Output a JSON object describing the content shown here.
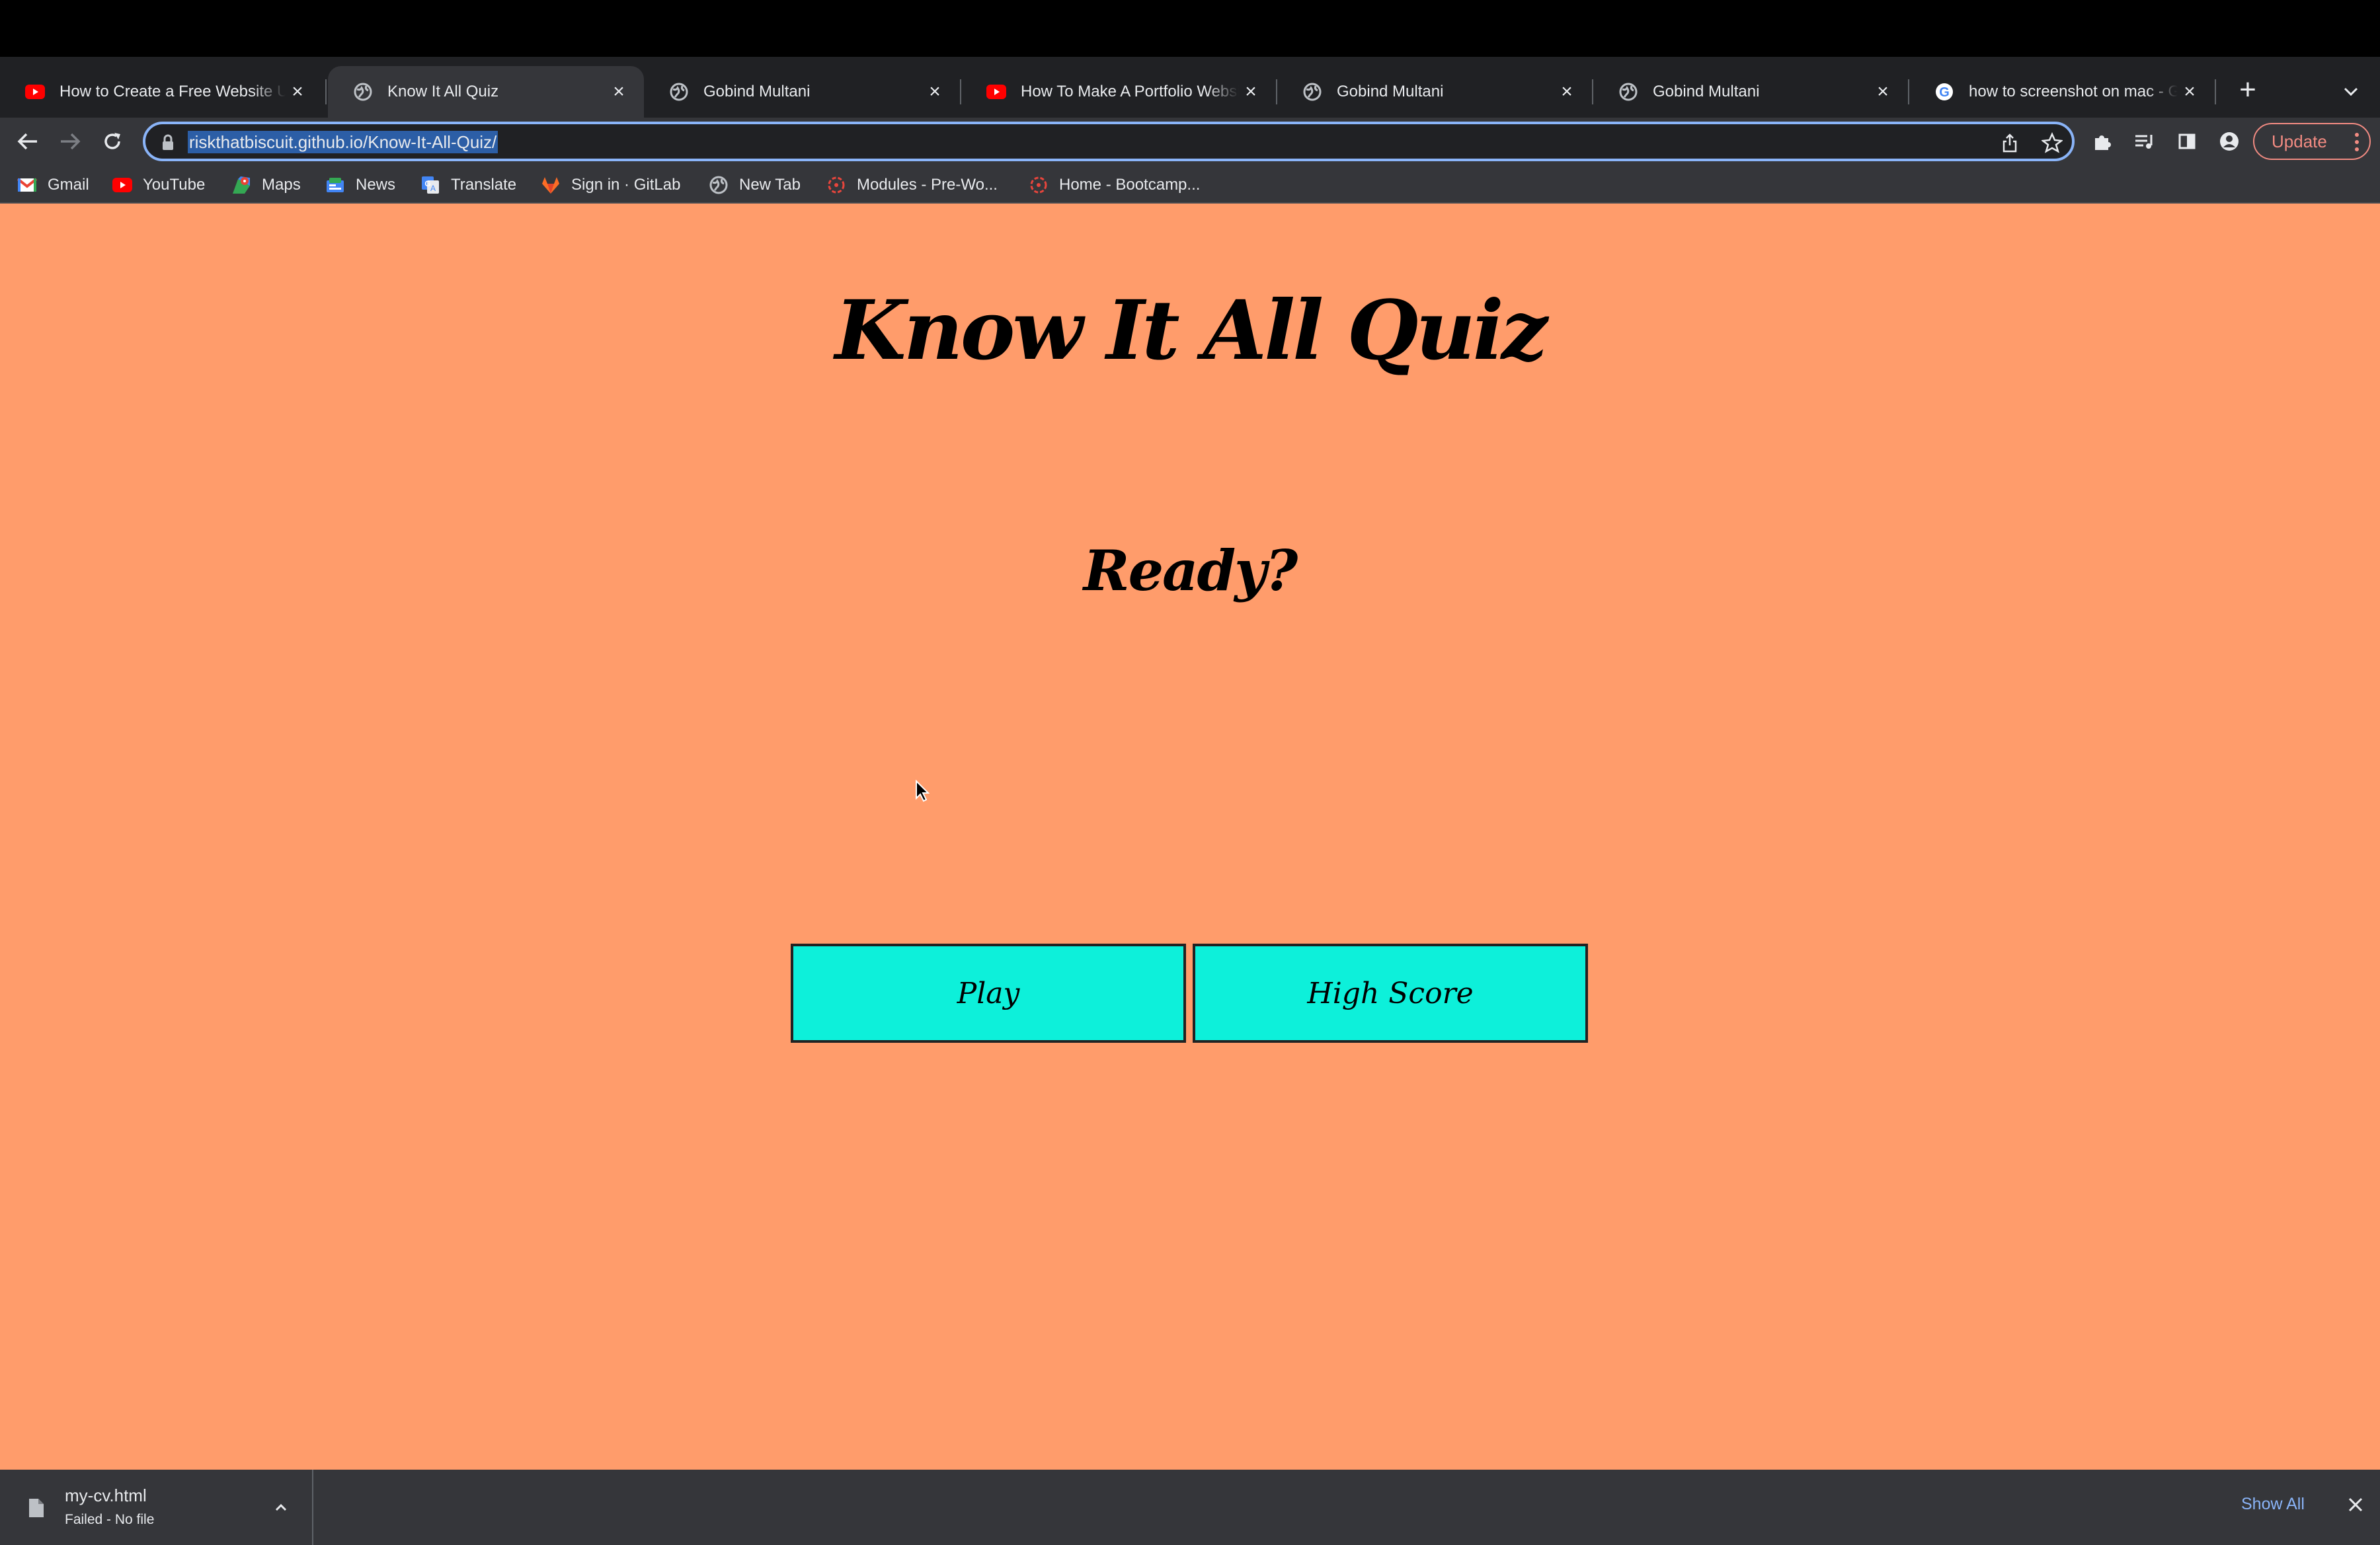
{
  "tabs": [
    {
      "title": "How to Create a Free Website Using GitHub Pages",
      "icon": "youtube-icon",
      "active": false
    },
    {
      "title": "Know It All Quiz",
      "icon": "globe-icon",
      "active": true
    },
    {
      "title": "Gobind Multani",
      "icon": "globe-icon",
      "active": false
    },
    {
      "title": "How To Make A Portfolio Website",
      "icon": "youtube-icon",
      "active": false
    },
    {
      "title": "Gobind Multani",
      "icon": "globe-icon",
      "active": false
    },
    {
      "title": "Gobind Multani",
      "icon": "globe-icon",
      "active": false
    },
    {
      "title": "how to screenshot on mac - Google Search",
      "icon": "google-icon",
      "active": false
    }
  ],
  "address_bar": {
    "url": "riskthatbiscuit.github.io/Know-It-All-Quiz/"
  },
  "toolbar": {
    "update_label": "Update"
  },
  "bookmarks": [
    {
      "label": "Gmail",
      "icon": "gmail-icon"
    },
    {
      "label": "YouTube",
      "icon": "youtube-icon"
    },
    {
      "label": "Maps",
      "icon": "maps-icon"
    },
    {
      "label": "News",
      "icon": "news-icon"
    },
    {
      "label": "Translate",
      "icon": "translate-icon"
    },
    {
      "label": "Sign in · GitLab",
      "icon": "gitlab-icon"
    },
    {
      "label": "New Tab",
      "icon": "globe-icon"
    },
    {
      "label": "Modules - Pre-Wo...",
      "icon": "bootcamp-icon"
    },
    {
      "label": "Home - Bootcamp...",
      "icon": "bootcamp-icon"
    }
  ],
  "page": {
    "title": "Know It All Quiz",
    "subtitle": "Ready?",
    "play_label": "Play",
    "highscore_label": "High Score"
  },
  "downloads": {
    "file_name": "my-cv.html",
    "status": "Failed - No file",
    "show_all_label": "Show All"
  },
  "colors": {
    "page_background": "#ff9c6b",
    "button_background": "#0df0da",
    "accent": "#8ab4f8",
    "update_accent": "#f28b82"
  }
}
